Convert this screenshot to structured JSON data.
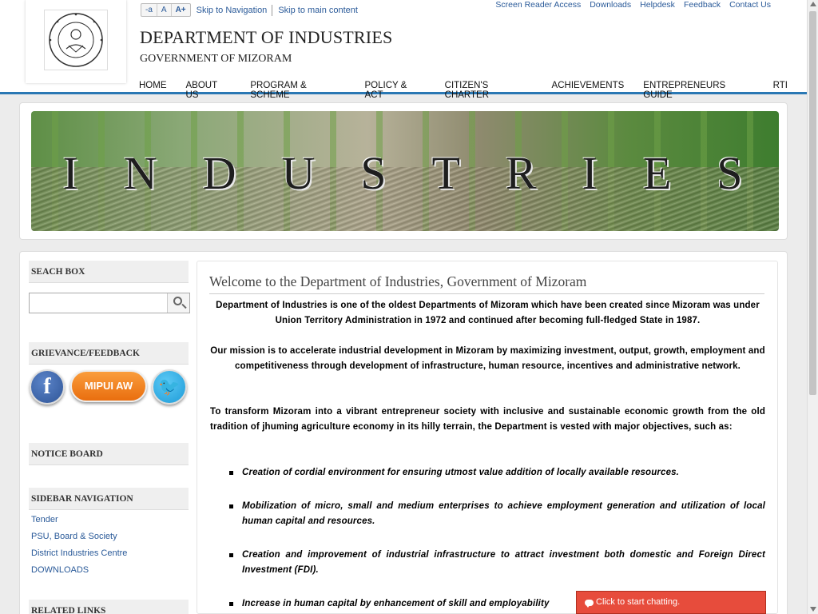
{
  "header": {
    "font_size_controls": [
      "-a",
      "A",
      "A+"
    ],
    "skip_navigation": "Skip to Navigation",
    "skip_main": "Skip to main content",
    "utility_links": [
      "Screen Reader Access",
      "Downloads",
      "Helpdesk",
      "Feedback",
      "Contact Us"
    ],
    "title": "DEPARTMENT OF INDUSTRIES",
    "subtitle": "GOVERNMENT OF MIZORAM",
    "logo_icon": "government-seal-icon"
  },
  "nav": {
    "items": [
      "HOME",
      "ABOUT US",
      "PROGRAM & SCHEME",
      "POLICY & ACT",
      "CITIZEN'S CHARTER",
      "ACHIEVEMENTS",
      "ENTREPRENEURS GUIDE",
      "RTI"
    ]
  },
  "banner": {
    "letters": [
      "I",
      "N",
      "D",
      "U",
      "S",
      "T",
      "R",
      "I",
      "E",
      "S"
    ]
  },
  "sidebar": {
    "search_heading": "SEACH BOX",
    "search_placeholder": "",
    "grievance_heading": "GRIEVANCE/FEEDBACK",
    "facebook_glyph": "f",
    "mipui_label": "MIPUI AW",
    "twitter_glyph": "🐦",
    "notice_heading": "NOTICE BOARD",
    "nav_heading": "SIDEBAR NAVIGATION",
    "nav_links": [
      "Tender",
      "PSU, Board & Society",
      "District Industries Centre",
      "DOWNLOADS"
    ],
    "related_heading": "RELATED LINKS"
  },
  "content": {
    "heading": "Welcome to the Department of Industries, Government of Mizoram",
    "intro": "Department of Industries is one of the oldest Departments of Mizoram which have been created since Mizoram was under Union Territory Administration in 1972 and continued after becoming full-fledged State in 1987.",
    "mission": "Our mission is to accelerate industrial development in Mizoram by maximizing investment, output, growth, employment and competitiveness through development of infrastructure, human resource, incentives and administrative network.",
    "transform": "To transform Mizoram into a vibrant entrepreneur society with inclusive and sustainable economic growth from the old tradition of jhuming agriculture economy in its hilly terrain, the Department is vested with major objectives, such as:",
    "objectives": [
      "Creation of cordial environment for ensuring utmost value addition of locally available resources.",
      "Mobilization of micro, small and medium enterprises to achieve employment generation and utilization of local human capital and resources.",
      "Creation and improvement of industrial infrastructure to attract investment both domestic and Foreign Direct Investment (FDI).",
      "Increase in human capital by enhancement of skill and employability"
    ]
  },
  "chat": {
    "label": "Click to start chatting."
  }
}
